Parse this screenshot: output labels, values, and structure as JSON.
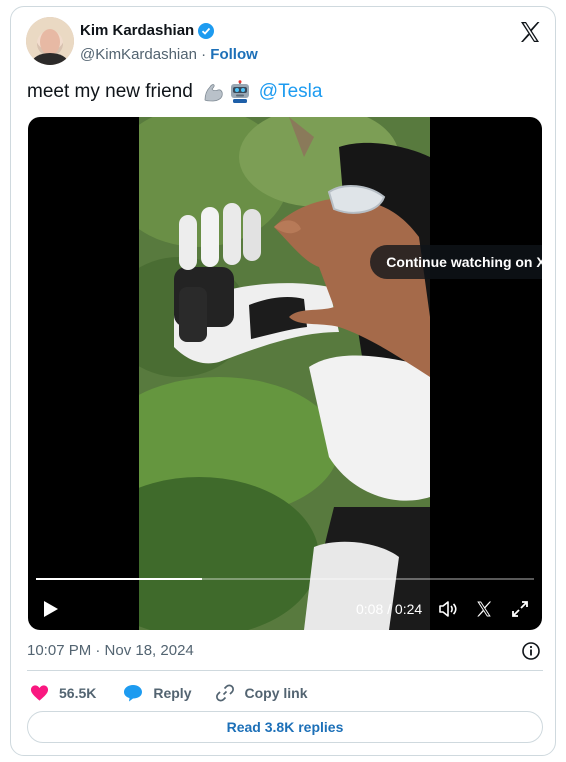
{
  "author": {
    "name": "Kim Kardashian",
    "handle": "@KimKardashian",
    "separator": "·",
    "follow_label": "Follow"
  },
  "tweet": {
    "text": "meet my new friend",
    "mention": "@Tesla",
    "emojis": [
      "flexed-biceps",
      "robot"
    ]
  },
  "media": {
    "overlay_label": "Continue watching on X",
    "current_time": "0:08",
    "duration": "0:24",
    "progress_fraction": 0.333
  },
  "meta": {
    "timestamp": "10:07 PM · Nov 18, 2024"
  },
  "actions": {
    "likes": "56.5K",
    "reply_label": "Reply",
    "copy_link_label": "Copy link"
  },
  "read_replies_label": "Read 3.8K replies",
  "colors": {
    "accent": "#1d9bf0",
    "link": "#1d70b8",
    "heart": "#f91880",
    "muted": "#536471"
  }
}
